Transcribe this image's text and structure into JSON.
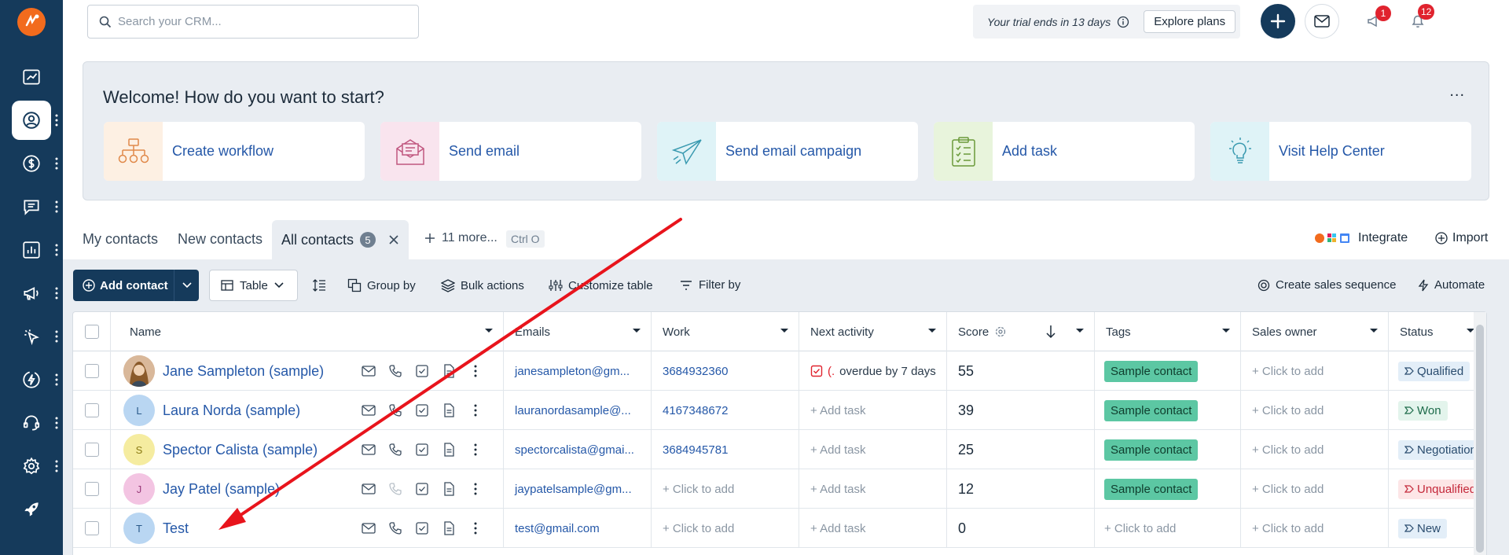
{
  "search": {
    "placeholder": "Search your CRM..."
  },
  "header": {
    "trial_text": "Your trial ends in 13 days",
    "explore_label": "Explore plans",
    "notif_badge_1": "1",
    "notif_badge_2": "12"
  },
  "sidebar": {
    "items": [
      {
        "icon": "dashboard-icon"
      },
      {
        "icon": "contacts-icon",
        "active": true
      },
      {
        "icon": "deals-icon"
      },
      {
        "icon": "conversations-icon"
      },
      {
        "icon": "reports-icon"
      },
      {
        "icon": "campaigns-icon"
      },
      {
        "icon": "cursor-icon"
      },
      {
        "icon": "automation-icon"
      },
      {
        "icon": "support-icon"
      },
      {
        "icon": "settings-icon"
      },
      {
        "icon": "rocket-icon"
      }
    ]
  },
  "welcome": {
    "title": "Welcome! How do you want to start?",
    "more": "...",
    "cards": [
      {
        "label": "Create workflow",
        "color": "#fdf0e3"
      },
      {
        "label": "Send email",
        "color": "#f9e4ee"
      },
      {
        "label": "Send email campaign",
        "color": "#dff3f7"
      },
      {
        "label": "Add task",
        "color": "#e8f4dc"
      },
      {
        "label": "Visit Help Center",
        "color": "#dff3f7"
      }
    ]
  },
  "tabs": {
    "my": "My contacts",
    "new": "New contacts",
    "all": "All contacts",
    "all_count": "5",
    "more": "11 more...",
    "shortcut": "Ctrl O",
    "integrate": "Integrate",
    "import": "Import"
  },
  "toolbar": {
    "add_contact": "Add contact",
    "view": "Table",
    "group_by": "Group by",
    "bulk_actions": "Bulk actions",
    "customize": "Customize table",
    "filter": "Filter by",
    "sales_sequence": "Create sales sequence",
    "automate": "Automate"
  },
  "table": {
    "headers": {
      "name": "Name",
      "emails": "Emails",
      "work": "Work",
      "next_activity": "Next activity",
      "score": "Score",
      "tags": "Tags",
      "owner": "Sales owner",
      "status": "Status"
    },
    "rows": [
      {
        "avatar": "",
        "name": "Jane Sampleton (sample)",
        "email": "janesampleton@gm...",
        "work": "3684932360",
        "activity_prefix": "(.",
        "activity": "overdue by 7 days",
        "score": "55",
        "tag": "Sample contact",
        "owner": "+ Click to add",
        "status": "Qualified"
      },
      {
        "avatar": "L",
        "name": "Laura Norda (sample)",
        "email": "lauranordasample@...",
        "work": "4167348672",
        "activity": "+ Add task",
        "score": "39",
        "tag": "Sample contact",
        "owner": "+ Click to add",
        "status": "Won"
      },
      {
        "avatar": "S",
        "name": "Spector Calista (sample)",
        "email": "spectorcalista@gmai...",
        "work": "3684945781",
        "activity": "+ Add task",
        "score": "25",
        "tag": "Sample contact",
        "owner": "+ Click to add",
        "status": "Negotiation"
      },
      {
        "avatar": "J",
        "name": "Jay Patel (sample)",
        "email": "jaypatelsample@gm...",
        "work": "+ Click to add",
        "activity": "+ Add task",
        "score": "12",
        "tag": "Sample contact",
        "owner": "+ Click to add",
        "status": "Unqualified"
      },
      {
        "avatar": "T",
        "name": "Test",
        "email": "test@gmail.com",
        "work": "+ Click to add",
        "activity": "+ Add task",
        "score": "0",
        "tag": "+ Click to add",
        "owner": "+ Click to add",
        "status": "New"
      }
    ]
  },
  "colors": {
    "sidebar": "#153a5b",
    "accent_link": "#2558a8",
    "arrow": "#e8141c",
    "tag": "#5cc7a3"
  }
}
